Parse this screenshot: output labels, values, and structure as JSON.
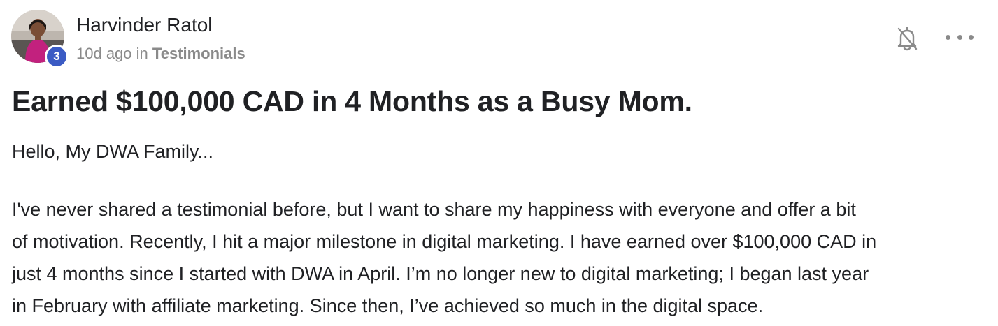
{
  "post": {
    "author": {
      "name": "Harvinder Ratol",
      "level": "3"
    },
    "meta": {
      "time": "10d ago",
      "in_word": "in",
      "category": "Testimonials"
    },
    "icons": {
      "bell": "bell-off-icon",
      "more": "more-horizontal-icon"
    },
    "title": "Earned $100,000 CAD in 4 Months as a Busy Mom.",
    "greeting": "Hello, My DWA Family...",
    "body_lines": [
      "I've never shared a testimonial before, but I want to share my happiness with everyone and offer a bit",
      "of motivation. Recently, I hit a major milestone in digital marketing. I have earned over $100,000 CAD in",
      "just 4 months since I started with DWA in April. I’m no longer new to digital marketing; I began last year",
      "in February with affiliate marketing. Since then, I’ve achieved so much in the digital space."
    ],
    "colors": {
      "level_badge": "#3b5bc4",
      "meta_text": "#8a8a8a",
      "text": "#202124"
    }
  }
}
